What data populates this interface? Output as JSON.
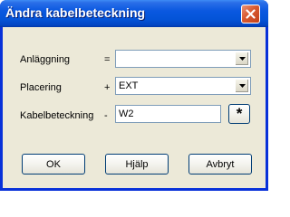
{
  "window": {
    "title": "Ändra kabelbeteckning"
  },
  "fields": [
    {
      "label": "Anläggning",
      "operator": "=",
      "value": ""
    },
    {
      "label": "Placering",
      "operator": "+",
      "value": "EXT"
    },
    {
      "label": "Kabelbeteckning",
      "operator": "-",
      "value": "W2"
    }
  ],
  "asterisk_button": {
    "label": "*"
  },
  "buttons": {
    "ok": "OK",
    "help": "Hjälp",
    "cancel": "Avbryt"
  },
  "icons": {
    "close": "close-icon",
    "dropdown": "chevron-down-icon"
  }
}
